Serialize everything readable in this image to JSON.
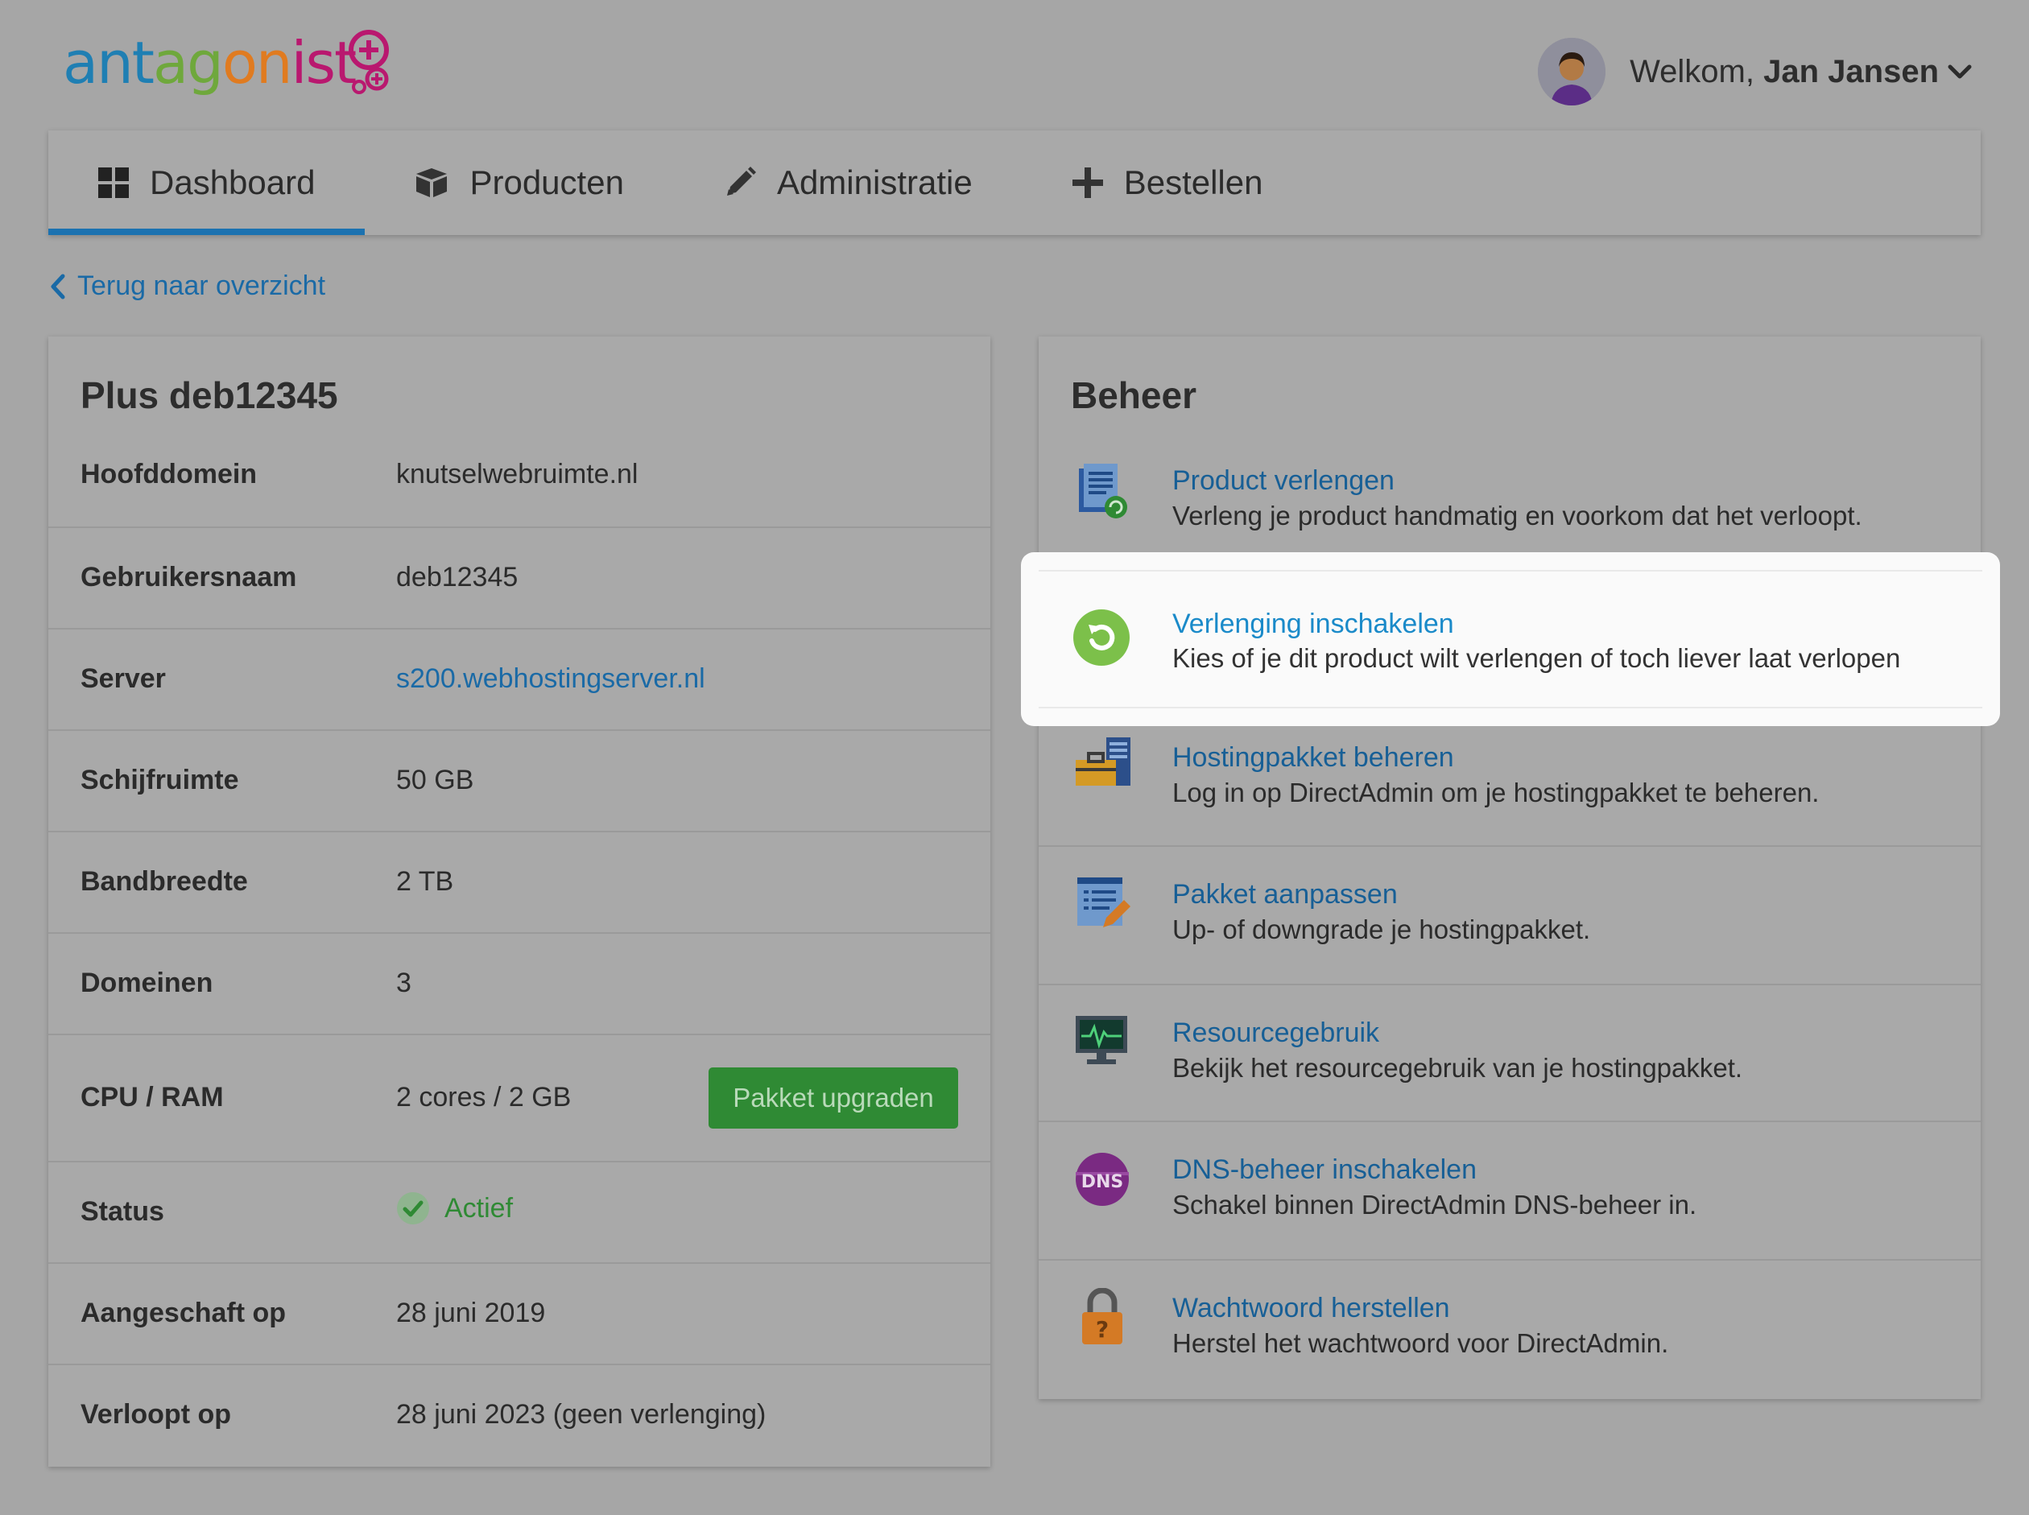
{
  "brand": {
    "logo_parts": [
      "ant",
      "ag",
      "on",
      "ist"
    ]
  },
  "user": {
    "welcome_prefix": "Welkom,",
    "name": "Jan Jansen"
  },
  "tabs": [
    {
      "label": "Dashboard",
      "icon": "grid-icon",
      "active": true
    },
    {
      "label": "Producten",
      "icon": "box-icon",
      "active": false
    },
    {
      "label": "Administratie",
      "icon": "pencil-icon",
      "active": false
    },
    {
      "label": "Bestellen",
      "icon": "plus-icon",
      "active": false
    }
  ],
  "back_link": "Terug naar overzicht",
  "product": {
    "title": "Plus deb12345",
    "rows": [
      {
        "label": "Hoofddomein",
        "value": "knutselwebruimte.nl"
      },
      {
        "label": "Gebruikersnaam",
        "value": "deb12345"
      },
      {
        "label": "Server",
        "value": "s200.webhostingserver.nl"
      },
      {
        "label": "Schijfruimte",
        "value": "50 GB"
      },
      {
        "label": "Bandbreedte",
        "value": "2 TB"
      },
      {
        "label": "Domeinen",
        "value": "3"
      },
      {
        "label": "CPU / RAM",
        "value": "2 cores / 2 GB"
      },
      {
        "label": "Status",
        "value": "Actief"
      },
      {
        "label": "Aangeschaft op",
        "value": "28 juni 2019"
      },
      {
        "label": "Verloopt op",
        "value": "28 juni 2023 (geen verlenging)"
      }
    ],
    "upgrade_button": "Pakket upgraden"
  },
  "beheer": {
    "title": "Beheer",
    "items": [
      {
        "title": "Product verlengen",
        "desc": "Verleng je product handmatig en voorkom dat het verloopt.",
        "icon": "renew-document-icon"
      },
      {
        "title": "Verlenging inschakelen",
        "desc": "Kies of je dit product wilt verlengen of toch liever laat verlopen",
        "icon": "refresh-icon"
      },
      {
        "title": "Hostingpakket beheren",
        "desc": "Log in op DirectAdmin om je hostingpakket te beheren.",
        "icon": "server-briefcase-icon"
      },
      {
        "title": "Pakket aanpassen",
        "desc": "Up- of downgrade je hostingpakket.",
        "icon": "edit-list-icon"
      },
      {
        "title": "Resourcegebruik",
        "desc": "Bekijk het resourcegebruik van je hostingpakket.",
        "icon": "monitor-icon"
      },
      {
        "title": "DNS-beheer inschakelen",
        "desc": "Schakel binnen DirectAdmin DNS-beheer in.",
        "icon": "dns-icon"
      },
      {
        "title": "Wachtwoord herstellen",
        "desc": "Herstel het wachtwoord voor DirectAdmin.",
        "icon": "padlock-icon"
      }
    ],
    "dns_badge": "DNS"
  }
}
